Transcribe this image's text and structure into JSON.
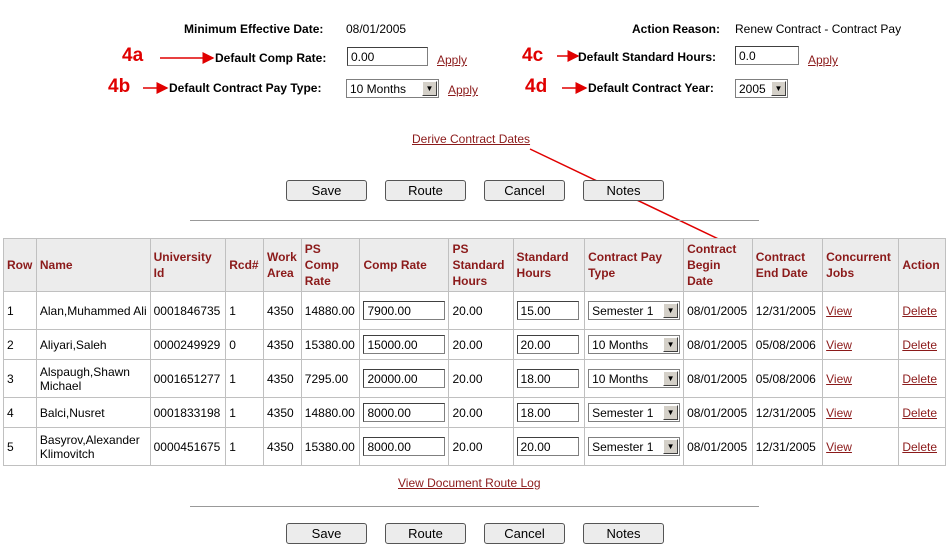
{
  "header": {
    "min_eff_date_label": "Minimum Effective Date:",
    "min_eff_date_value": "08/01/2005",
    "action_reason_label": "Action Reason:",
    "action_reason_value": "Renew Contract - Contract Pay"
  },
  "defaults": {
    "comp_rate": {
      "annotation": "4a",
      "label": "Default Comp Rate:",
      "value": "0.00",
      "apply": "Apply"
    },
    "pay_type": {
      "annotation": "4b",
      "label": "Default Contract Pay Type:",
      "value": "10 Months",
      "apply": "Apply"
    },
    "std_hours": {
      "annotation": "4c",
      "label": "Default Standard Hours:",
      "value": "0.0",
      "apply": "Apply"
    },
    "contract_year": {
      "annotation": "4d",
      "label": "Default Contract Year:",
      "value": "2005"
    }
  },
  "derive_link": "Derive Contract Dates",
  "buttons": {
    "save": "Save",
    "route": "Route",
    "cancel": "Cancel",
    "notes": "Notes"
  },
  "table": {
    "headers": {
      "row": "Row",
      "name": "Name",
      "university_id": "University Id",
      "rcd": "Rcd#",
      "work_area": "Work Area",
      "ps_comp_rate": "PS Comp Rate",
      "comp_rate": "Comp Rate",
      "ps_std_hours": "PS Standard Hours",
      "std_hours": "Standard Hours",
      "pay_type": "Contract Pay Type",
      "begin_date": "Contract Begin Date",
      "end_date": "Contract End Date",
      "concurrent": "Concurrent Jobs",
      "action": "Action"
    },
    "rows": [
      {
        "row": "1",
        "name": "Alan,Muhammed Ali",
        "id": "0001846735",
        "rcd": "1",
        "work_area": "4350",
        "ps_comp": "14880.00",
        "comp": "7900.00",
        "ps_hours": "20.00",
        "hours": "15.00",
        "pay_type": "Semester 1",
        "begin": "08/01/2005",
        "end": "12/31/2005",
        "view": "View",
        "delete": "Delete"
      },
      {
        "row": "2",
        "name": "Aliyari,Saleh",
        "id": "0000249929",
        "rcd": "0",
        "work_area": "4350",
        "ps_comp": "15380.00",
        "comp": "15000.00",
        "ps_hours": "20.00",
        "hours": "20.00",
        "pay_type": "10 Months",
        "begin": "08/01/2005",
        "end": "05/08/2006",
        "view": "View",
        "delete": "Delete"
      },
      {
        "row": "3",
        "name": "Alspaugh,Shawn Michael",
        "id": "0001651277",
        "rcd": "1",
        "work_area": "4350",
        "ps_comp": "7295.00",
        "comp": "20000.00",
        "ps_hours": "20.00",
        "hours": "18.00",
        "pay_type": "10 Months",
        "begin": "08/01/2005",
        "end": "05/08/2006",
        "view": "View",
        "delete": "Delete"
      },
      {
        "row": "4",
        "name": "Balci,Nusret",
        "id": "0001833198",
        "rcd": "1",
        "work_area": "4350",
        "ps_comp": "14880.00",
        "comp": "8000.00",
        "ps_hours": "20.00",
        "hours": "18.00",
        "pay_type": "Semester 1",
        "begin": "08/01/2005",
        "end": "12/31/2005",
        "view": "View",
        "delete": "Delete"
      },
      {
        "row": "5",
        "name": "Basyrov,Alexander Klimovitch",
        "id": "0000451675",
        "rcd": "1",
        "work_area": "4350",
        "ps_comp": "15380.00",
        "comp": "8000.00",
        "ps_hours": "20.00",
        "hours": "20.00",
        "pay_type": "Semester 1",
        "begin": "08/01/2005",
        "end": "12/31/2005",
        "view": "View",
        "delete": "Delete"
      }
    ]
  },
  "route_log_link": "View Document Route Log",
  "colors": {
    "annotation": "#e00000",
    "link": "#8b1a1a",
    "header_bg": "#ececec"
  }
}
